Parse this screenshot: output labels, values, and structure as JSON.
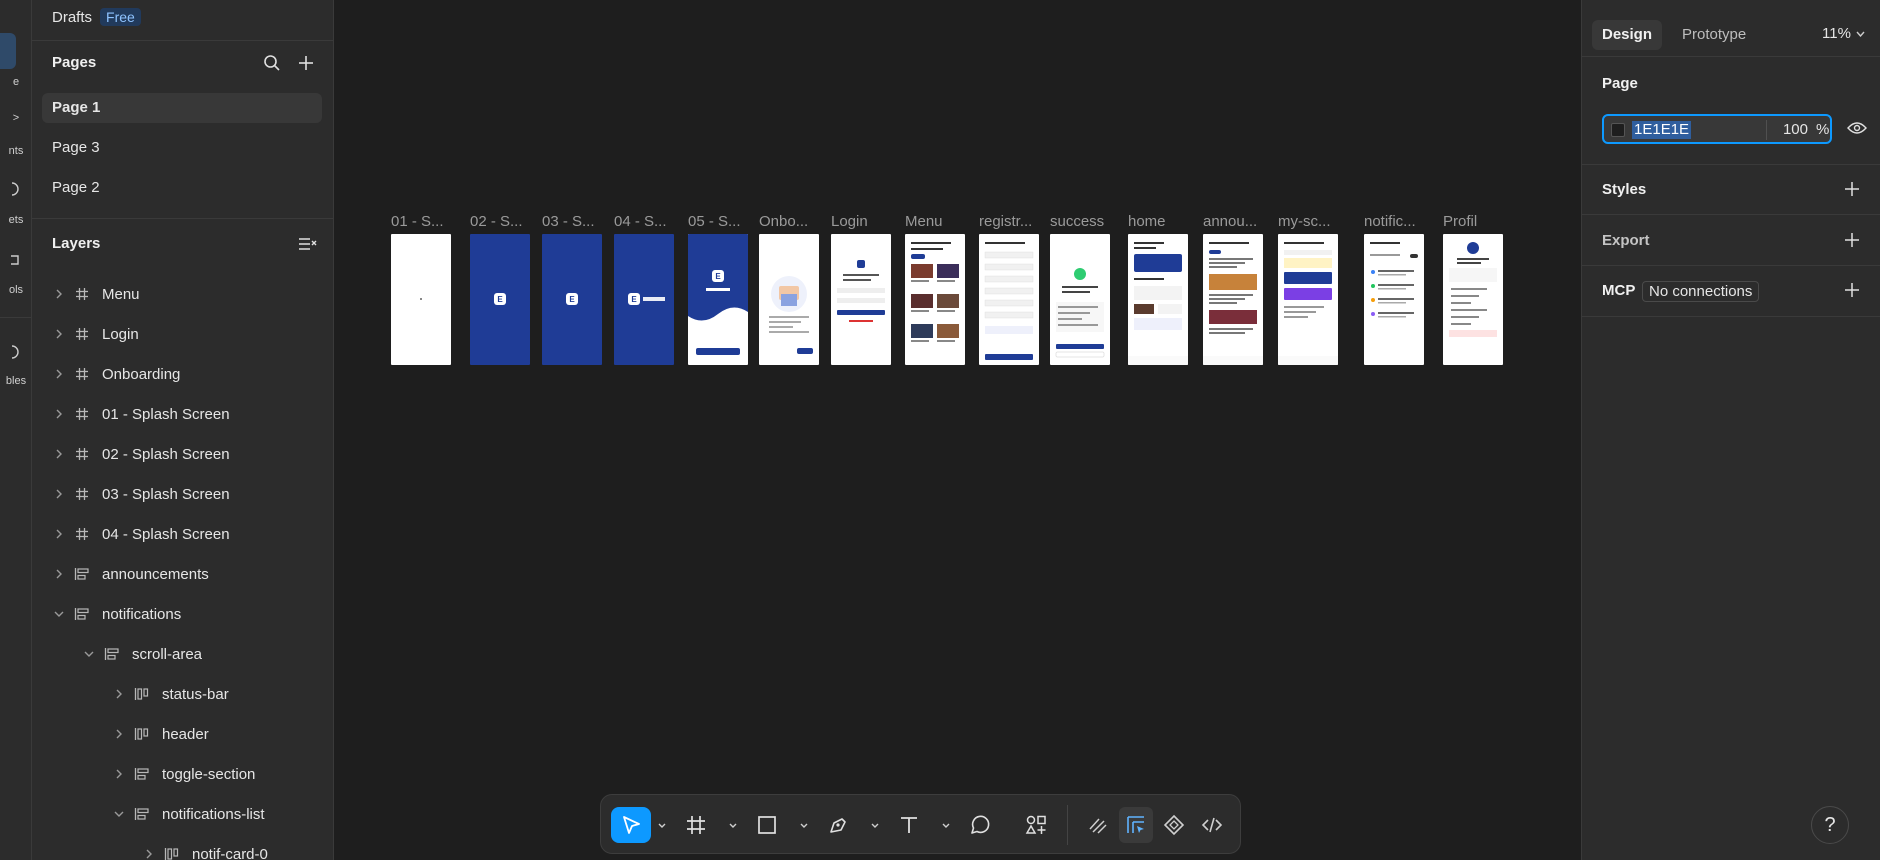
{
  "rail": {
    "items": [
      "e",
      ">",
      "nts",
      "ets",
      "ols",
      "bles"
    ]
  },
  "left": {
    "drafts_label": "Drafts",
    "plan_badge": "Free",
    "pages_title": "Pages",
    "pages": [
      {
        "label": "Page 1",
        "active": true
      },
      {
        "label": "Page 3",
        "active": false
      },
      {
        "label": "Page 2",
        "active": false
      }
    ],
    "layers_title": "Layers",
    "layers": [
      {
        "label": "Menu",
        "icon": "frame-icon",
        "depth": 0,
        "expanded": false
      },
      {
        "label": "Login",
        "icon": "frame-icon",
        "depth": 0,
        "expanded": false
      },
      {
        "label": "Onboarding",
        "icon": "frame-icon",
        "depth": 0,
        "expanded": false
      },
      {
        "label": "01 - Splash Screen",
        "icon": "frame-icon",
        "depth": 0,
        "expanded": false
      },
      {
        "label": "02 - Splash Screen",
        "icon": "frame-icon",
        "depth": 0,
        "expanded": false
      },
      {
        "label": "03 - Splash Screen",
        "icon": "frame-icon",
        "depth": 0,
        "expanded": false
      },
      {
        "label": "04 - Splash Screen",
        "icon": "frame-icon",
        "depth": 0,
        "expanded": false
      },
      {
        "label": "announcements",
        "icon": "autolayout-vertical-icon",
        "depth": 0,
        "expanded": false
      },
      {
        "label": "notifications",
        "icon": "autolayout-vertical-icon",
        "depth": 0,
        "expanded": true
      },
      {
        "label": "scroll-area",
        "icon": "autolayout-vertical-icon",
        "depth": 1,
        "expanded": true
      },
      {
        "label": "status-bar",
        "icon": "autolayout-horizontal-icon",
        "depth": 2,
        "expanded": false
      },
      {
        "label": "header",
        "icon": "autolayout-horizontal-icon",
        "depth": 2,
        "expanded": false
      },
      {
        "label": "toggle-section",
        "icon": "autolayout-vertical-icon",
        "depth": 2,
        "expanded": false
      },
      {
        "label": "notifications-list",
        "icon": "autolayout-vertical-icon",
        "depth": 2,
        "expanded": true
      },
      {
        "label": "notif-card-0",
        "icon": "autolayout-horizontal-icon",
        "depth": 3,
        "expanded": false
      }
    ]
  },
  "canvas": {
    "frames": [
      {
        "label": "01 - S...",
        "style": "white"
      },
      {
        "label": "02 - S...",
        "style": "blue-logo"
      },
      {
        "label": "03 - S...",
        "style": "blue-logo"
      },
      {
        "label": "04 - S...",
        "style": "blue-logo-text"
      },
      {
        "label": "05 - S...",
        "style": "blue-wave"
      },
      {
        "label": "Onbo...",
        "style": "onboarding"
      },
      {
        "label": "Login",
        "style": "login"
      },
      {
        "label": "Menu",
        "style": "menu"
      },
      {
        "label": "registr...",
        "style": "form"
      },
      {
        "label": "success",
        "style": "success"
      },
      {
        "label": "home",
        "style": "home"
      },
      {
        "label": "annou...",
        "style": "announcements"
      },
      {
        "label": "my-sc...",
        "style": "schedule"
      },
      {
        "label": "notific...",
        "style": "notifications"
      },
      {
        "label": "Profil",
        "style": "profile"
      }
    ]
  },
  "right": {
    "tabs": [
      {
        "label": "Design",
        "active": true
      },
      {
        "label": "Prototype",
        "active": false
      }
    ],
    "zoom": "11%",
    "page_section": "Page",
    "page_fill_hex": "1E1E1E",
    "page_fill_opacity": "100",
    "page_fill_unit": "%",
    "styles_section": "Styles",
    "export_section": "Export",
    "mcp_section": "MCP",
    "mcp_status": "No connections"
  },
  "help_label": "?",
  "colors": {
    "accent": "#0d99ff",
    "canvas": "#1e1e1e",
    "panel": "#2c2c2c",
    "app_blue": "#1f3c96"
  }
}
